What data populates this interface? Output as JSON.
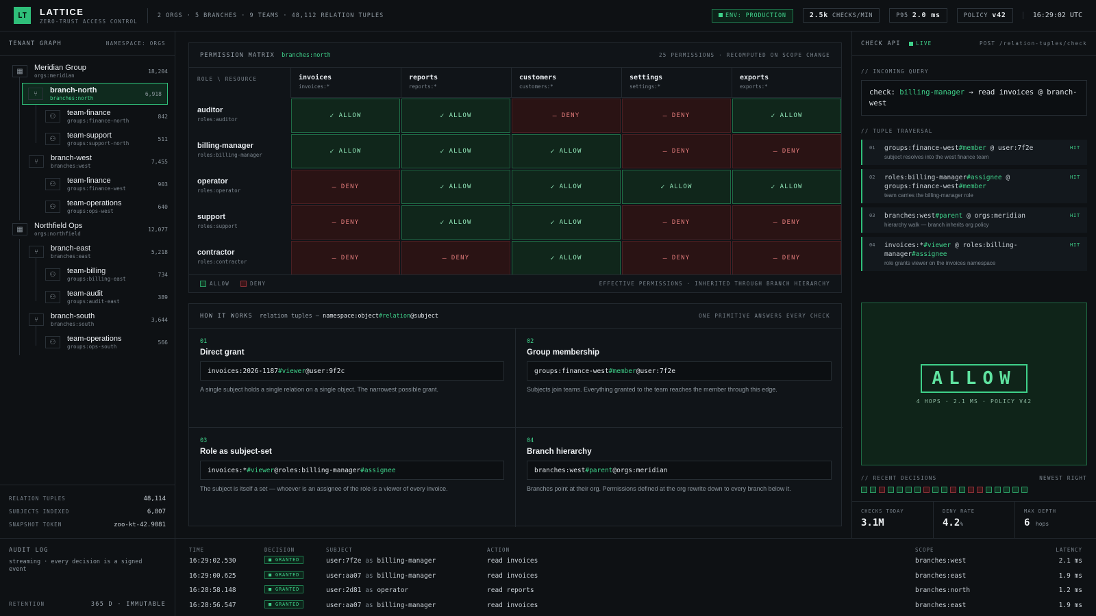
{
  "header": {
    "logo": "LT",
    "title": "LATTICE",
    "subtitle": "ZERO-TRUST ACCESS CONTROL",
    "stats": "2 ORGS · 5 BRANCHES · 9 TEAMS · 48,112 RELATION TUPLES",
    "env": "ENV: PRODUCTION",
    "checks_value": "2.5k",
    "checks_label": "CHECKS/MIN",
    "p95_label": "P95",
    "p95_value": "2.0 ms",
    "policy_label": "POLICY",
    "policy_value": "v42",
    "clock": "16:29:02 UTC"
  },
  "sidebar": {
    "title": "TENANT GRAPH",
    "namespace": "NAMESPACE: ORGS",
    "nodes": [
      {
        "name": "Meridian Group",
        "ns": "orgs:meridian",
        "count": "18,204",
        "icon": "building-icon"
      },
      {
        "name": "branch-north",
        "ns": "branches:north",
        "count": "6,918",
        "icon": "branch-icon"
      },
      {
        "name": "team-finance",
        "ns": "groups:finance-north",
        "count": "842",
        "icon": "team-icon"
      },
      {
        "name": "team-support",
        "ns": "groups:support-north",
        "count": "511",
        "icon": "team-icon"
      },
      {
        "name": "branch-west",
        "ns": "branches:west",
        "count": "7,455",
        "icon": "branch-icon"
      },
      {
        "name": "team-finance",
        "ns": "groups:finance-west",
        "count": "903",
        "icon": "team-icon"
      },
      {
        "name": "team-operations",
        "ns": "groups:ops-west",
        "count": "640",
        "icon": "team-icon"
      },
      {
        "name": "Northfield Ops",
        "ns": "orgs:northfield",
        "count": "12,077",
        "icon": "building-icon"
      },
      {
        "name": "branch-east",
        "ns": "branches:east",
        "count": "5,218",
        "icon": "branch-icon"
      },
      {
        "name": "team-billing",
        "ns": "groups:billing-east",
        "count": "734",
        "icon": "team-icon"
      },
      {
        "name": "team-audit",
        "ns": "groups:audit-east",
        "count": "389",
        "icon": "team-icon"
      },
      {
        "name": "branch-south",
        "ns": "branches:south",
        "count": "3,644",
        "icon": "branch-icon"
      },
      {
        "name": "team-operations",
        "ns": "groups:ops-south",
        "count": "566",
        "icon": "team-icon"
      }
    ],
    "stats": [
      {
        "k": "RELATION TUPLES",
        "v": "48,114"
      },
      {
        "k": "SUBJECTS INDEXED",
        "v": "6,807"
      },
      {
        "k": "SNAPSHOT TOKEN",
        "v": "zoo-kt-42.9081"
      }
    ]
  },
  "matrix": {
    "title": "PERMISSION MATRIX",
    "scope": "branches:north",
    "meta": "25 PERMISSIONS · RECOMPUTED ON SCOPE CHANGE",
    "corner": "ROLE \\ RESOURCE",
    "columns": [
      {
        "name": "invoices",
        "sub": "invoices:*"
      },
      {
        "name": "reports",
        "sub": "reports:*"
      },
      {
        "name": "customers",
        "sub": "customers:*"
      },
      {
        "name": "settings",
        "sub": "settings:*"
      },
      {
        "name": "exports",
        "sub": "exports:*"
      }
    ],
    "rows": [
      {
        "name": "auditor",
        "sub": "roles:auditor",
        "cells": [
          "ALLOW",
          "ALLOW",
          "DENY",
          "DENY",
          "ALLOW"
        ]
      },
      {
        "name": "billing-manager",
        "sub": "roles:billing-manager",
        "cells": [
          "ALLOW",
          "ALLOW",
          "ALLOW",
          "DENY",
          "DENY"
        ]
      },
      {
        "name": "operator",
        "sub": "roles:operator",
        "cells": [
          "DENY",
          "ALLOW",
          "ALLOW",
          "ALLOW",
          "ALLOW"
        ]
      },
      {
        "name": "support",
        "sub": "roles:support",
        "cells": [
          "DENY",
          "ALLOW",
          "ALLOW",
          "DENY",
          "DENY"
        ]
      },
      {
        "name": "contractor",
        "sub": "roles:contractor",
        "cells": [
          "DENY",
          "DENY",
          "ALLOW",
          "DENY",
          "DENY"
        ]
      }
    ],
    "legend_allow": "ALLOW",
    "legend_deny": "DENY",
    "footer": "EFFECTIVE PERMISSIONS · INHERITED THROUGH BRANCH HIERARCHY"
  },
  "how": {
    "title": "HOW IT WORKS",
    "desc_pre": "relation tuples —",
    "desc_a": "namespace:object",
    "desc_b": "#relation",
    "desc_c": "@subject",
    "right": "ONE PRIMITIVE ANSWERS EVERY CHECK",
    "cards": [
      {
        "n": "01",
        "t": "Direct grant",
        "c1": "invoices:2026-1187",
        "c2": "#viewer",
        "c3": "@user:9f2c",
        "c4": "",
        "d": "A single subject holds a single relation on a single object. The narrowest possible grant."
      },
      {
        "n": "02",
        "t": "Group membership",
        "c1": "groups:finance-west",
        "c2": "#member",
        "c3": "@user:7f2e",
        "c4": "",
        "d": "Subjects join teams. Everything granted to the team reaches the member through this edge."
      },
      {
        "n": "03",
        "t": "Role as subject-set",
        "c1": "invoices:*",
        "c2": "#viewer",
        "c3": "@roles:billing-manager",
        "c4": "#assignee",
        "d": "The subject is itself a set — whoever is an assignee of the role is a viewer of every invoice."
      },
      {
        "n": "04",
        "t": "Branch hierarchy",
        "c1": "branches:west",
        "c2": "#parent",
        "c3": "@orgs:meridian",
        "c4": "",
        "d": "Branches point at their org. Permissions defined at the org rewrite down to every branch below it."
      }
    ]
  },
  "check": {
    "title": "CHECK API",
    "live": "LIVE",
    "endpoint": "POST /relation-tuples/check",
    "incoming_label": "// INCOMING QUERY",
    "q_prefix": "check:",
    "q_role": "billing-manager",
    "q_arrow": "→",
    "q_action": "read invoices @",
    "q_scope": "branch-west",
    "traversal_label": "// TUPLE TRAVERSAL",
    "steps": [
      {
        "i": "01",
        "c": "groups:finance-west#member @ user:7f2e",
        "s": "subject resolves into the west finance team",
        "h": "HIT"
      },
      {
        "i": "02",
        "c": "roles:billing-manager#assignee @ groups:finance-west#member",
        "s": "team carries the billing-manager role",
        "h": "HIT"
      },
      {
        "i": "03",
        "c": "branches:west#parent @ orgs:meridian",
        "s": "hierarchy walk — branch inherits org policy",
        "h": "HIT"
      },
      {
        "i": "04",
        "c": "invoices:*#viewer @ roles:billing-manager#assignee",
        "s": "role grants viewer on the invoices namespace",
        "h": "HIT"
      }
    ],
    "verdict": "ALLOW",
    "verdict_sub": "4 HOPS · 2.1 MS · POLICY V42",
    "recent_label": "// RECENT DECISIONS",
    "recent_right": "NEWEST RIGHT",
    "recent": [
      "g",
      "g",
      "r",
      "g",
      "g",
      "g",
      "g",
      "r",
      "g",
      "g",
      "r",
      "g",
      "r",
      "r",
      "g",
      "g",
      "g",
      "g",
      "g"
    ],
    "kpis": [
      {
        "k": "CHECKS TODAY",
        "v": "3.1M",
        "u": ""
      },
      {
        "k": "DENY RATE",
        "v": "4.2",
        "u": "%"
      },
      {
        "k": "MAX DEPTH",
        "v": "6",
        "u": "hops"
      }
    ]
  },
  "audit": {
    "title": "AUDIT LOG",
    "desc": "streaming · every decision is a signed event",
    "retention_k": "RETENTION",
    "retention_v": "365 D · IMMUTABLE",
    "headers": [
      "TIME",
      "DECISION",
      "SUBJECT",
      "ACTION",
      "SCOPE",
      "LATENCY"
    ],
    "as": "as",
    "rows": [
      {
        "time": "16:29:02.530",
        "decision": "GRANTED",
        "user": "user:7f2e",
        "role": "billing-manager",
        "action": "read invoices",
        "scope": "branches:west",
        "lat": "2.1 ms"
      },
      {
        "time": "16:29:00.625",
        "decision": "GRANTED",
        "user": "user:aa07",
        "role": "billing-manager",
        "action": "read invoices",
        "scope": "branches:east",
        "lat": "1.9 ms"
      },
      {
        "time": "16:28:58.148",
        "decision": "GRANTED",
        "user": "user:2d81",
        "role": "operator",
        "action": "read reports",
        "scope": "branches:north",
        "lat": "1.2 ms"
      },
      {
        "time": "16:28:56.547",
        "decision": "GRANTED",
        "user": "user:aa07",
        "role": "billing-manager",
        "action": "read invoices",
        "scope": "branches:east",
        "lat": "1.9 ms"
      }
    ]
  }
}
